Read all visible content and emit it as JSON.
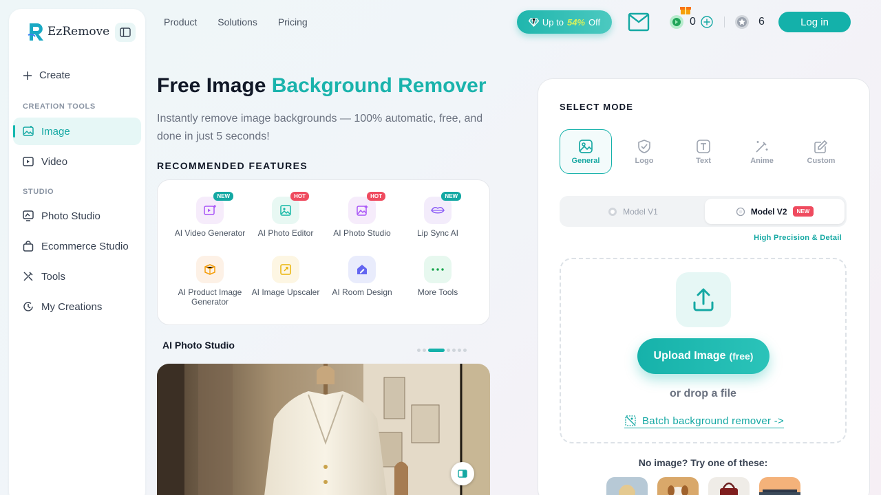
{
  "sidebar": {
    "brand": "EzRemove",
    "create_label": "Create",
    "section_creation": "CREATION TOOLS",
    "section_studio": "STUDIO",
    "items": [
      {
        "label": "Image",
        "icon": "image-icon",
        "active": true
      },
      {
        "label": "Video",
        "icon": "video-icon",
        "active": false
      },
      {
        "label": "Photo Studio",
        "icon": "photo-studio-icon",
        "active": false
      },
      {
        "label": "Ecommerce Studio",
        "icon": "shopping-bag-icon",
        "active": false
      },
      {
        "label": "Tools",
        "icon": "tools-icon",
        "active": false
      },
      {
        "label": "My Creations",
        "icon": "history-icon",
        "active": false
      }
    ]
  },
  "topnav": {
    "links": [
      "Product",
      "Solutions",
      "Pricing"
    ],
    "promo_prefix": "Up to",
    "promo_percent": "54%",
    "promo_suffix": "Off",
    "coins": "0",
    "stars": "6",
    "login_label": "Log in"
  },
  "hero": {
    "title_plain": "Free Image",
    "title_accent": "Background Remover",
    "subtitle": "Instantly remove image backgrounds — 100% automatic, free, and done in just 5 seconds!"
  },
  "features": {
    "heading": "RECOMMENDED FEATURES",
    "items": [
      {
        "label": "AI Video Generator",
        "badge": "NEW",
        "icon": "video-sparkle-icon"
      },
      {
        "label": "AI Photo Editor",
        "badge": "HOT",
        "icon": "photo-edit-icon"
      },
      {
        "label": "AI Photo Studio",
        "badge": "HOT",
        "icon": "photo-studio-icon"
      },
      {
        "label": "Lip Sync AI",
        "badge": "NEW",
        "icon": "lips-icon"
      },
      {
        "label": "AI Product Image Generator",
        "badge": "",
        "icon": "product-box-icon"
      },
      {
        "label": "AI Image Upscaler",
        "badge": "",
        "icon": "upscale-icon"
      },
      {
        "label": "AI Room Design",
        "badge": "",
        "icon": "room-design-icon"
      },
      {
        "label": "More Tools",
        "badge": "",
        "icon": "more-dots-icon"
      }
    ]
  },
  "studio": {
    "title": "AI Photo Studio",
    "carousel_count": 7,
    "carousel_active": 3
  },
  "panel": {
    "select_mode": "SELECT MODE",
    "modes": [
      {
        "label": "General",
        "icon": "general-image-icon",
        "active": true
      },
      {
        "label": "Logo",
        "icon": "shield-check-icon",
        "active": false
      },
      {
        "label": "Text",
        "icon": "text-icon",
        "active": false
      },
      {
        "label": "Anime",
        "icon": "wand-icon",
        "active": false
      },
      {
        "label": "Custom",
        "icon": "edit-icon",
        "active": false
      }
    ],
    "model_v1": "Model V1",
    "model_v2": "Model V2",
    "model_v2_badge": "NEW",
    "precision_note": "High Precision & Detail",
    "upload_label": "Upload Image",
    "upload_free": "(free)",
    "drop_text": "or drop a file",
    "batch_label": "Batch background remover ->",
    "try_label": "No image? Try one of these:"
  },
  "colors": {
    "accent": "#14b1aa",
    "hot": "#ef4b5f"
  }
}
